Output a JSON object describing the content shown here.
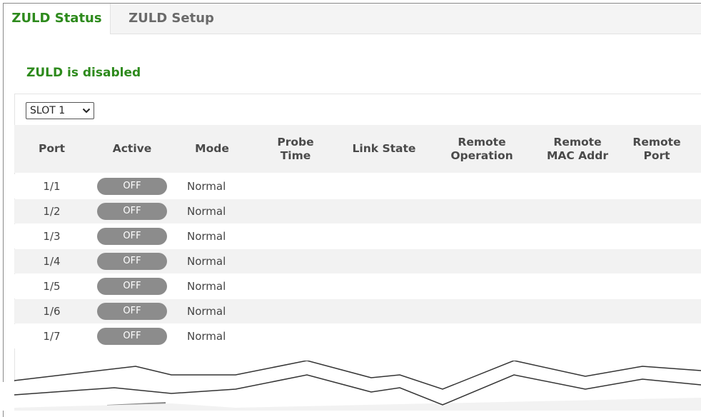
{
  "tabs": [
    {
      "label": "ZULD Status",
      "active": true
    },
    {
      "label": "ZULD Setup",
      "active": false
    }
  ],
  "status_message": "ZULD is disabled",
  "slot_selector": {
    "selected": "SLOT 1"
  },
  "table": {
    "headers": {
      "port": "Port",
      "active": "Active",
      "mode": "Mode",
      "probe_time": [
        "Probe",
        "Time"
      ],
      "link_state": "Link State",
      "remote_operation": [
        "Remote",
        "Operation"
      ],
      "remote_mac_addr": [
        "Remote",
        "MAC Addr"
      ],
      "remote_port": [
        "Remote",
        "Port"
      ]
    },
    "rows": [
      {
        "port": "1/1",
        "active": "OFF",
        "mode": "Normal"
      },
      {
        "port": "1/2",
        "active": "OFF",
        "mode": "Normal"
      },
      {
        "port": "1/3",
        "active": "OFF",
        "mode": "Normal"
      },
      {
        "port": "1/4",
        "active": "OFF",
        "mode": "Normal"
      },
      {
        "port": "1/5",
        "active": "OFF",
        "mode": "Normal"
      },
      {
        "port": "1/6",
        "active": "OFF",
        "mode": "Normal"
      },
      {
        "port": "1/7",
        "active": "OFF",
        "mode": "Normal"
      }
    ]
  },
  "colors": {
    "accent_green": "#2d8a1c",
    "toggle_off": "#8c8c8c",
    "row_alt": "#f2f2f2"
  }
}
